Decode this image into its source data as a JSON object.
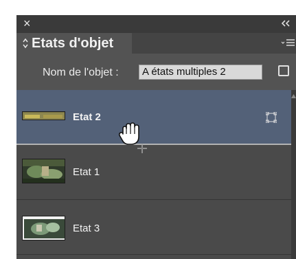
{
  "panel": {
    "close_glyph": "×",
    "collapse_icon": "double-chevron-left-icon",
    "tab_title": "Etats d'objet",
    "menu_icon": "panel-menu-icon"
  },
  "object_name": {
    "label": "Nom de l'objet :",
    "value": "A états multiples 2"
  },
  "states": [
    {
      "label": "Etat 2",
      "selected": true
    },
    {
      "label": "Etat 1",
      "selected": false
    },
    {
      "label": "Etat 3",
      "selected": false
    }
  ],
  "colors": {
    "panel_bg": "#535353",
    "selected_row": "#536178",
    "list_bg": "#4a4a4a"
  }
}
